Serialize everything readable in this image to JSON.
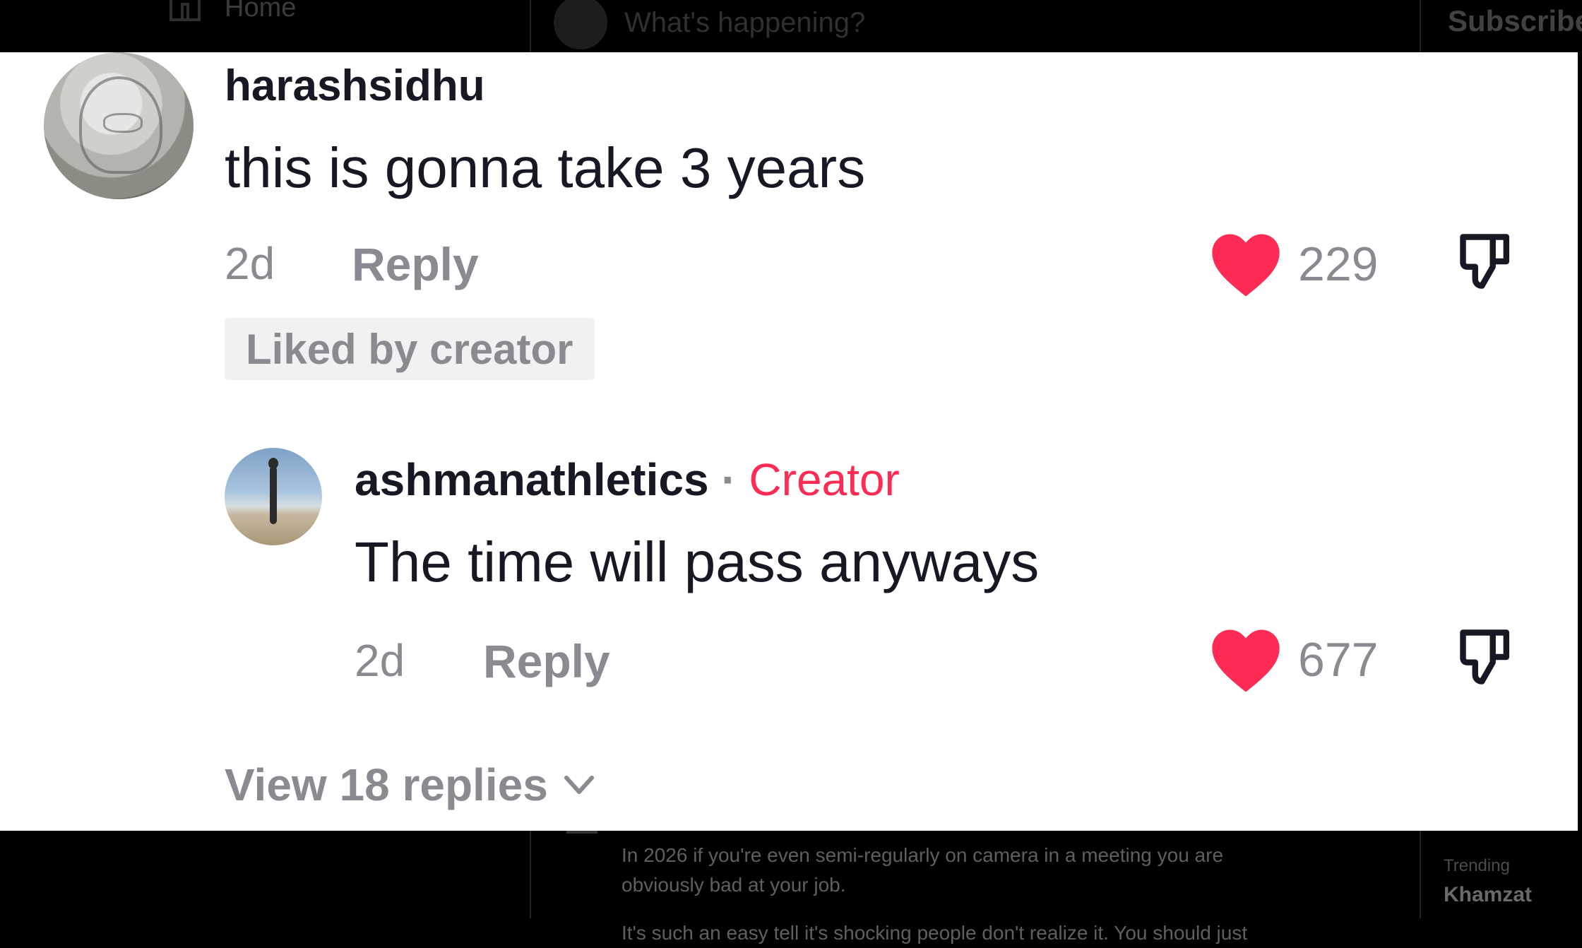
{
  "background_app": {
    "nav_home_label": "Home",
    "compose_placeholder": "What's happening?",
    "subscribe_label": "Subscribe",
    "post_text_line1": "In 2026 if you're even semi-regularly on camera in a meeting you are",
    "post_text_line2": "obviously bad at your job.",
    "post_text_line3": "It's such an easy tell it's shocking people don't realize it. You should just",
    "trending_label": "Trending",
    "trending_name": "Khamzat"
  },
  "comments": [
    {
      "username": "harashsidhu",
      "text": "this is gonna take 3 years",
      "age": "2d",
      "reply_label": "Reply",
      "likes": "229",
      "liked_by_creator_label": "Liked by creator"
    },
    {
      "username": "ashmanathletics",
      "separator": "·",
      "creator_label": "Creator",
      "text": "The time will pass anyways",
      "age": "2d",
      "reply_label": "Reply",
      "likes": "677"
    }
  ],
  "view_replies_label": "View 18 replies",
  "colors": {
    "like_heart": "#fe2c55",
    "creator_tag": "#fe2c55",
    "muted_text": "#8a8b91",
    "primary_text": "#161823",
    "card_background": "#ffffff",
    "page_background": "#000000"
  },
  "icons": [
    "home-icon",
    "heart-icon",
    "dislike-icon",
    "chevron-down-icon"
  ]
}
